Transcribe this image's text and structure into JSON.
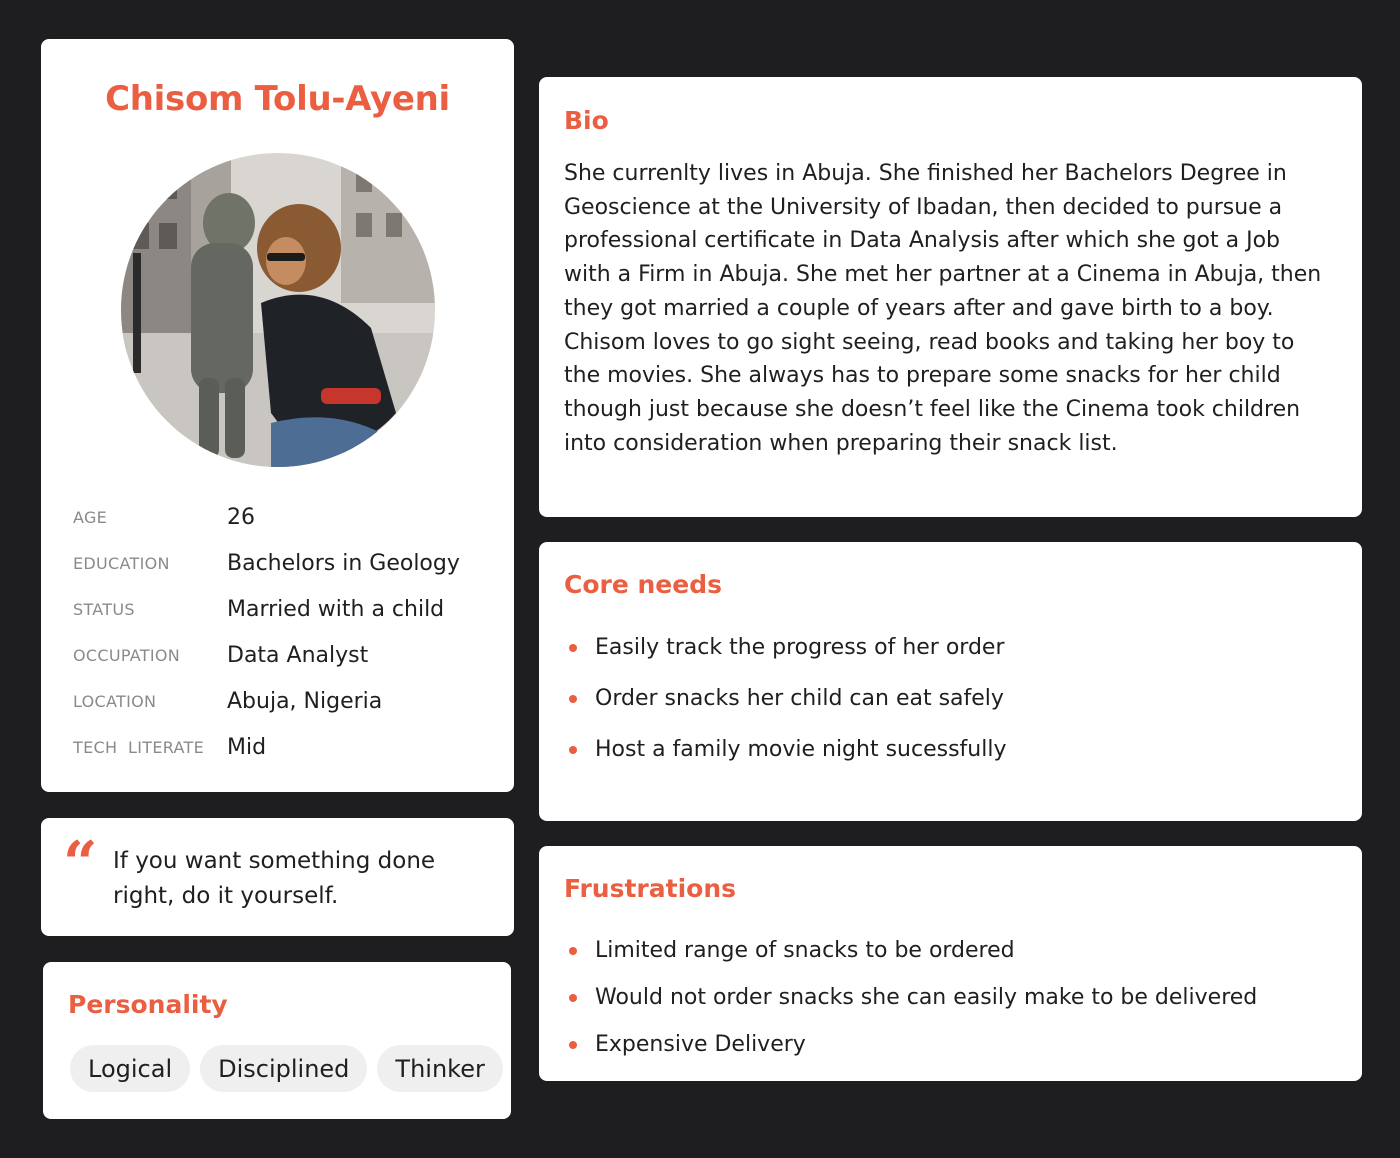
{
  "profile": {
    "name": "Chisom Tolu-Ayeni",
    "photo_icon": "persona-photo",
    "details": [
      {
        "label": "AGE",
        "value": "26"
      },
      {
        "label": "EDUCATION",
        "value": "Bachelors in Geology"
      },
      {
        "label": "STATUS",
        "value": "Married with a child"
      },
      {
        "label": "OCCUPATION",
        "value": "Data Analyst"
      },
      {
        "label": "LOCATION",
        "value": "Abuja, Nigeria"
      },
      {
        "label": "TECH  LITERATE",
        "value": "Mid"
      }
    ]
  },
  "quote": {
    "icon": "quote-icon",
    "mark": "“",
    "text": "If you want something done right, do it yourself."
  },
  "personality": {
    "title": "Personality",
    "traits": [
      "Logical",
      "Disciplined",
      "Thinker"
    ]
  },
  "bio": {
    "title": "Bio",
    "text": "She currenlty lives in Abuja. She finished her Bachelors Degree in Geoscience at the University of Ibadan, then decided to pursue a professional certificate in Data Analysis after which she got a Job with a Firm in Abuja. She met her partner at a Cinema in Abuja, then they got married a couple of years after and gave birth to a boy. Chisom loves to go sight seeing, read books and taking her boy to the movies. She always has to prepare some snacks for her child though just because she doesn’t feel like the Cinema took children into consideration when preparing their snack list."
  },
  "core_needs": {
    "title": "Core needs",
    "items": [
      "Easily track the progress of her order",
      "Order snacks her child can eat safely",
      "Host a family movie night sucessfully"
    ]
  },
  "frustrations": {
    "title": "Frustrations",
    "items": [
      "Limited range of snacks to be ordered",
      "Would not order snacks she can easily make to be delivered",
      "Expensive Delivery"
    ]
  },
  "colors": {
    "accent": "#ea5f41",
    "background": "#1e1e20",
    "card": "#ffffff",
    "tag_bg": "#efefef"
  }
}
